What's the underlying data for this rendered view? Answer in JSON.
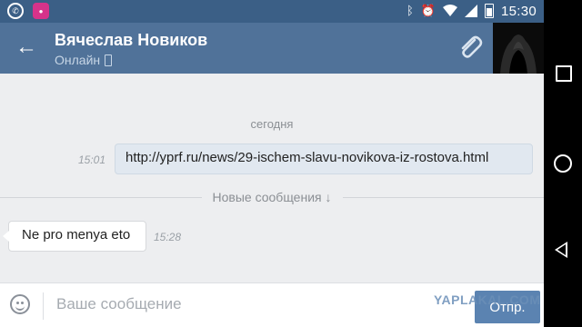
{
  "status_bar": {
    "time": "15:30",
    "app_icons": [
      "whatsapp-icon",
      "game-app-icon"
    ],
    "system_icons": [
      "bluetooth-icon",
      "alarm-icon",
      "wifi-icon",
      "signal-icon",
      "battery-icon"
    ]
  },
  "header": {
    "contact_name": "Вячеслав Новиков",
    "status": "Онлайн"
  },
  "chat": {
    "date_separator": "сегодня",
    "messages": [
      {
        "direction": "outgoing",
        "text": "http://yprf.ru/news/29-ischem-slavu-novikova-iz-rostova.html",
        "time": "15:01"
      },
      {
        "direction": "incoming",
        "text": "Ne pro menya eto",
        "time": "15:28"
      }
    ],
    "new_messages_label": "Новые сообщения"
  },
  "composer": {
    "placeholder": "Ваше сообщение",
    "value": "",
    "send_label": "Отпр."
  },
  "watermark": "YAPLAKAL.COM",
  "colors": {
    "header": "#507299",
    "status_bar": "#3b5f86",
    "chat_bg": "#edeef0",
    "outgoing_bubble": "#e1e8f0",
    "send_button": "#5b83b1"
  }
}
